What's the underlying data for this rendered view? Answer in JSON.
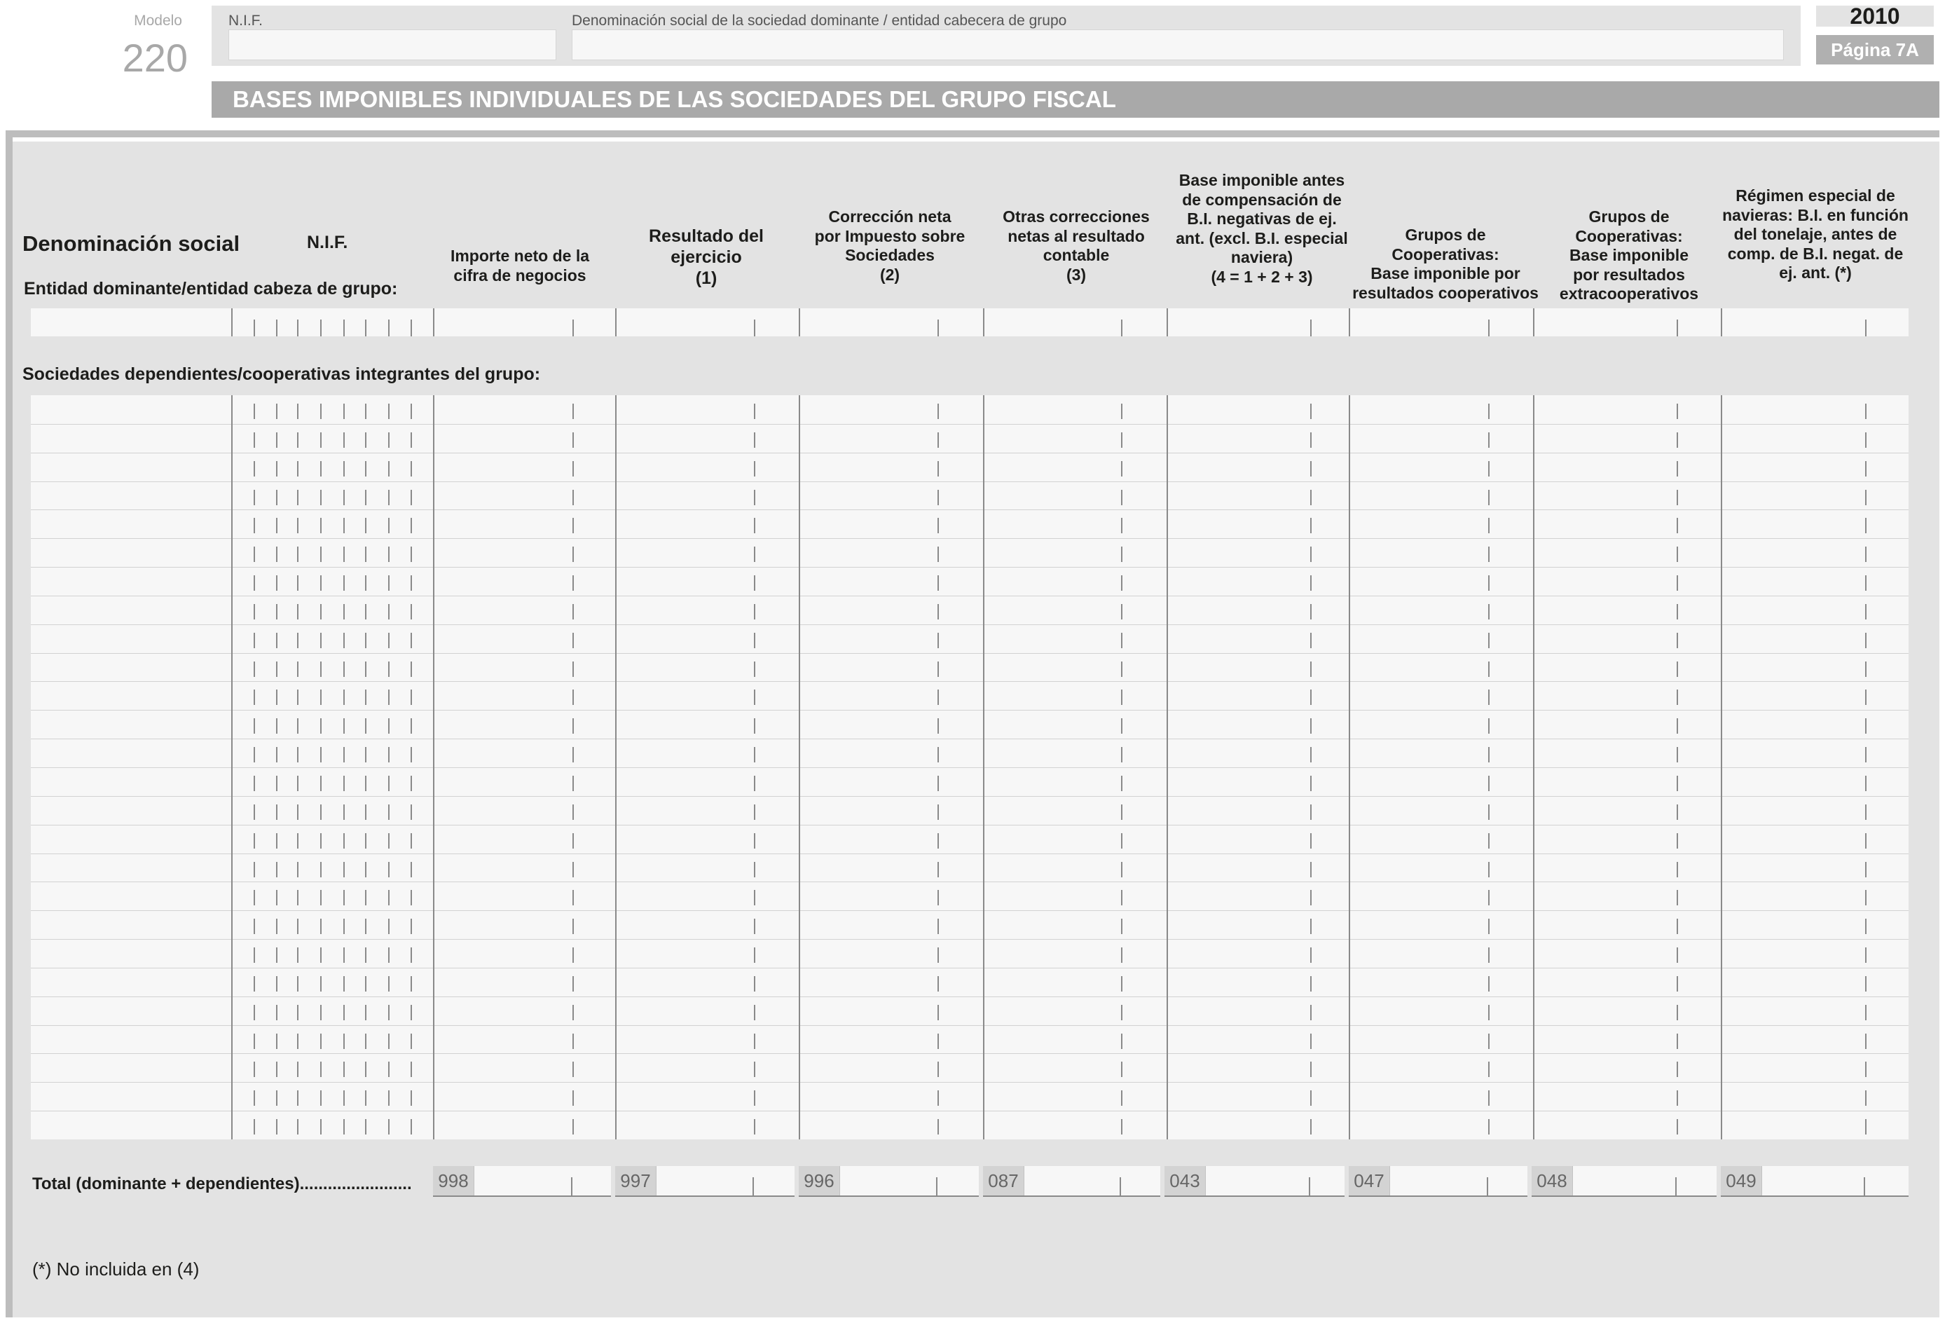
{
  "header": {
    "modelo_label": "Modelo",
    "modelo_number": "220",
    "nif_label": "N.I.F.",
    "denominacion_label": "Denominación social de la sociedad dominante / entidad cabecera de grupo",
    "year": "2010",
    "page": "Página 7A"
  },
  "title": "BASES IMPONIBLES INDIVIDUALES DE LAS SOCIEDADES DEL GRUPO FISCAL",
  "columns": {
    "denominacion": "Denominación social",
    "nif": "N.I.F.",
    "importe": [
      "Importe neto de la",
      "cifra de negocios"
    ],
    "resultado": [
      "Resultado del",
      "ejercicio",
      "(1)"
    ],
    "correccion": [
      "Corrección neta",
      "por Impuesto sobre",
      "Sociedades",
      "(2)"
    ],
    "otras": [
      "Otras correcciones",
      "netas al resultado",
      "contable",
      "(3)"
    ],
    "base": [
      "Base imponible antes",
      "de compensación de",
      "B.I. negativas de ej.",
      "ant. (excl. B.I. especial",
      "naviera)",
      "(4 = 1 + 2 + 3)"
    ],
    "coop1": [
      "Grupos de Cooperativas:",
      "Base imponible por",
      "resultados cooperativos"
    ],
    "coop2": [
      "Grupos de Cooperativas:",
      "Base imponible",
      "por resultados",
      "extracooperativos"
    ],
    "naviera": [
      "Régimen especial de",
      "navieras: B.I. en función",
      "del tonelaje, antes de",
      "comp. de B.I. negat. de",
      "ej. ant. (*)"
    ]
  },
  "sections": {
    "dominante": "Entidad dominante/entidad cabeza de grupo:",
    "dependientes": "Sociedades dependientes/cooperativas integrantes del grupo:"
  },
  "total": {
    "label": "Total (dominante + dependientes)........................",
    "codes": [
      "998",
      "997",
      "996",
      "087",
      "043",
      "047",
      "048",
      "049"
    ]
  },
  "footnote": "(*) No incluida en (4)"
}
